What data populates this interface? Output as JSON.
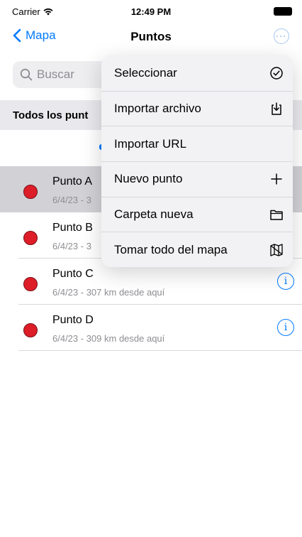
{
  "status": {
    "carrier": "Carrier",
    "time": "12:49 PM"
  },
  "nav": {
    "back_label": "Mapa",
    "title": "Puntos"
  },
  "search": {
    "placeholder": "Buscar"
  },
  "section": {
    "header": "Todos los punt"
  },
  "points": [
    {
      "name": "Punto A",
      "subtitle": "6/4/23 - 3",
      "selected": true
    },
    {
      "name": "Punto B",
      "subtitle": "6/4/23 - 3",
      "selected": false
    },
    {
      "name": "Punto C",
      "subtitle": "6/4/23 - 307 km desde aquí",
      "selected": false
    },
    {
      "name": "Punto D",
      "subtitle": "6/4/23 - 309 km desde aquí",
      "selected": false
    }
  ],
  "menu": [
    {
      "label": "Seleccionar",
      "icon": "checkmark-circle-icon"
    },
    {
      "label": "Importar archivo",
      "icon": "import-file-icon"
    },
    {
      "label": "Importar URL",
      "icon": ""
    },
    {
      "label": "Nuevo punto",
      "icon": "plus-icon"
    },
    {
      "label": "Carpeta nueva",
      "icon": "folder-icon"
    },
    {
      "label": "Tomar todo del mapa",
      "icon": "map-icon"
    }
  ],
  "colors": {
    "accent": "#007aff",
    "point": "#dd1d28",
    "menu_bg": "#f2f2f4"
  }
}
